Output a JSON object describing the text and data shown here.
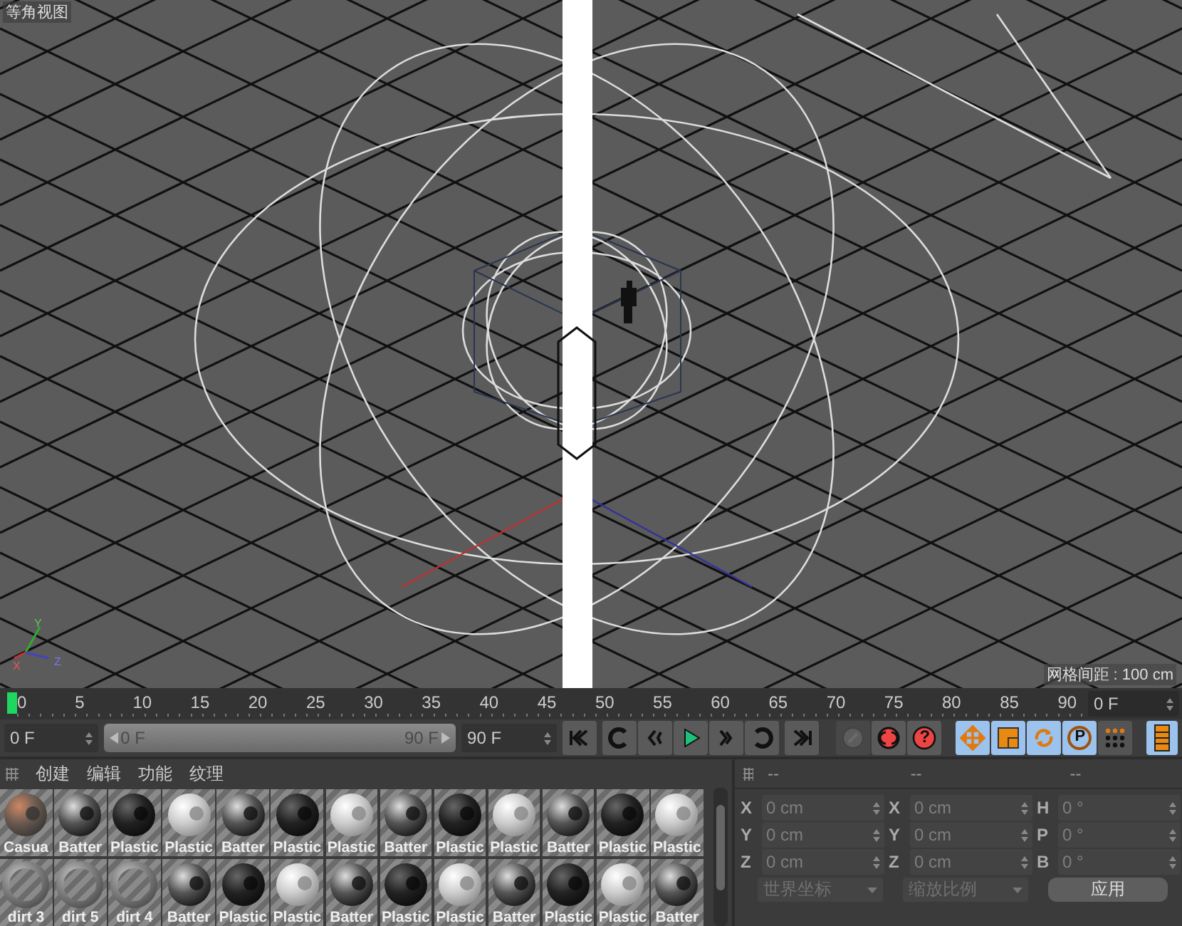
{
  "viewport": {
    "title": "等角视图",
    "grid_spacing": "网格间距 : 100 cm",
    "axis_labels": [
      "Y",
      "X",
      "Z"
    ]
  },
  "timeline": {
    "ticks": [
      "0",
      "5",
      "10",
      "15",
      "20",
      "25",
      "30",
      "35",
      "40",
      "45",
      "50",
      "55",
      "60",
      "65",
      "70",
      "75",
      "80",
      "85",
      "90"
    ],
    "current_frame": "0 F"
  },
  "transport": {
    "start_field": "0 F",
    "range_start": "0 F",
    "range_end": "90 F",
    "range_slider": {
      "level": 1
    },
    "end_field": "90 F",
    "key_buttons": [
      {
        "kind": "record",
        "disabled": true
      },
      {
        "kind": "autokey",
        "disabled": false
      },
      {
        "kind": "help",
        "symbol": "?",
        "disabled": false
      }
    ],
    "tools": [
      {
        "kind": "move",
        "selected": true
      },
      {
        "kind": "scale",
        "selected": true
      },
      {
        "kind": "rotate",
        "selected": true
      },
      {
        "kind": "param",
        "symbol": "P",
        "selected": true
      },
      {
        "kind": "points",
        "selected": false
      }
    ],
    "timeline_toggle": {
      "selected": true
    }
  },
  "materials": {
    "menu": [
      "创建",
      "编辑",
      "功能",
      "纹理"
    ],
    "items": [
      {
        "label": "Casua",
        "kind": "camo"
      },
      {
        "label": "Batter",
        "kind": "metal"
      },
      {
        "label": "Plastic",
        "kind": "black"
      },
      {
        "label": "Plastic",
        "kind": "white"
      },
      {
        "label": "Batter",
        "kind": "metal"
      },
      {
        "label": "Plastic",
        "kind": "black"
      },
      {
        "label": "Plastic",
        "kind": "white"
      },
      {
        "label": "Batter",
        "kind": "metal"
      },
      {
        "label": "Plastic",
        "kind": "black"
      },
      {
        "label": "Plastic",
        "kind": "white"
      },
      {
        "label": "Batter",
        "kind": "metal"
      },
      {
        "label": "Plastic",
        "kind": "black"
      },
      {
        "label": "Plastic",
        "kind": "white"
      },
      {
        "label": "dirt 3",
        "kind": "dirt"
      },
      {
        "label": "dirt 5",
        "kind": "dirt"
      },
      {
        "label": "dirt 4",
        "kind": "dirt"
      },
      {
        "label": "Batter",
        "kind": "metal"
      },
      {
        "label": "Plastic",
        "kind": "black"
      },
      {
        "label": "Plastic",
        "kind": "white"
      },
      {
        "label": "Batter",
        "kind": "metal"
      },
      {
        "label": "Plastic",
        "kind": "black"
      },
      {
        "label": "Plastic",
        "kind": "white"
      },
      {
        "label": "Batter",
        "kind": "metal"
      },
      {
        "label": "Plastic",
        "kind": "black"
      },
      {
        "label": "Plastic",
        "kind": "white"
      },
      {
        "label": "Batter",
        "kind": "metal"
      }
    ]
  },
  "coordinates": {
    "headers": [
      "--",
      "--",
      "--"
    ],
    "columns": [
      [
        {
          "axis": "X",
          "value": "0 cm"
        },
        {
          "axis": "Y",
          "value": "0 cm"
        },
        {
          "axis": "Z",
          "value": "0 cm"
        }
      ],
      [
        {
          "axis": "X",
          "value": "0 cm"
        },
        {
          "axis": "Y",
          "value": "0 cm"
        },
        {
          "axis": "Z",
          "value": "0 cm"
        }
      ],
      [
        {
          "axis": "H",
          "value": "0 °"
        },
        {
          "axis": "P",
          "value": "0 °"
        },
        {
          "axis": "B",
          "value": "0 °"
        }
      ]
    ],
    "dropdowns": [
      {
        "label": "世界坐标",
        "disabled": true
      },
      {
        "label": "缩放比例",
        "disabled": true
      }
    ],
    "apply_button": "应用"
  }
}
